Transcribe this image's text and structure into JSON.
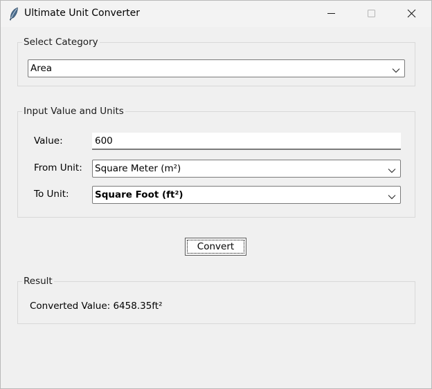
{
  "window": {
    "title": "Ultimate Unit Converter",
    "icon": "feather-icon",
    "controls": [
      "minimize-icon",
      "maximize-icon",
      "close-icon"
    ]
  },
  "category": {
    "legend": "Select Category",
    "selected": "Area"
  },
  "input": {
    "legend": "Input Value and Units",
    "value_label": "Value:",
    "value": "600",
    "from_label": "From Unit:",
    "from_selected": "Square Meter (m²)",
    "to_label": "To Unit:",
    "to_selected": "Square Foot (ft²)"
  },
  "convert_button": {
    "label": "Convert"
  },
  "result": {
    "legend": "Result",
    "text": "Converted Value: 6458.35ft²"
  },
  "colors": {
    "window_bg": "#f0f0f0",
    "titlebar_bg": "#f3f3f3",
    "field_border": "#7a7a7a",
    "group_border": "#d8d8d8"
  }
}
